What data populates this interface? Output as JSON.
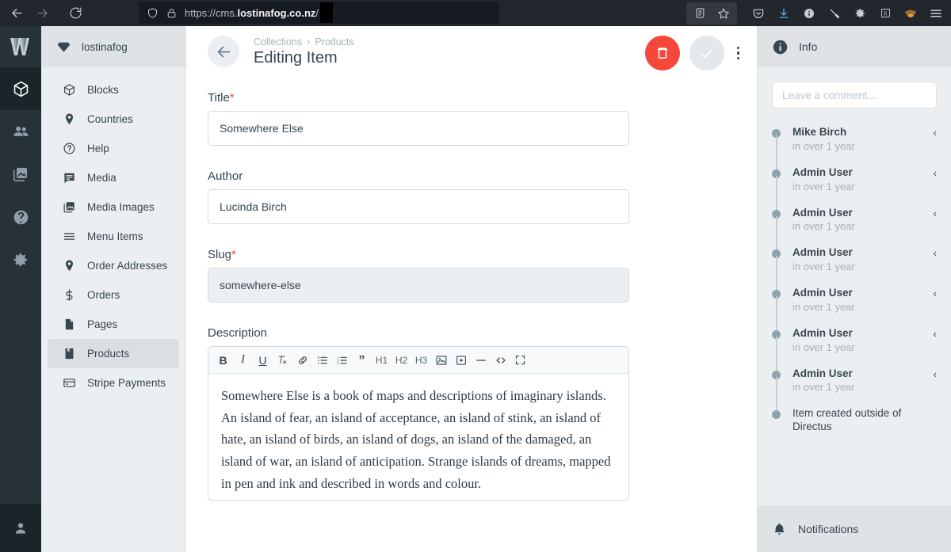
{
  "browser": {
    "back_icon": "arrow-left-icon",
    "forward_icon": "arrow-right-icon",
    "reload_icon": "reload-icon",
    "shield_icon": "shield-icon",
    "lock_icon": "lock-icon",
    "url_prefix": "https://cms.",
    "url_domain": "lostinafog.co.nz",
    "url_suffix": "/",
    "reader_icon": "reader-view-icon",
    "bookmark_icon": "star-icon",
    "extensions": [
      "pocket-icon",
      "downloads-icon",
      "info-circle-icon",
      "pen-icon",
      "gear-icon",
      "r-badge-icon",
      "monkey-avatar-icon"
    ],
    "menu_icon": "hamburger-menu-icon"
  },
  "modulebar": {
    "brand_label": "W",
    "items": [
      {
        "name": "content",
        "icon": "cube-icon",
        "active": true
      },
      {
        "name": "users",
        "icon": "users-icon",
        "active": false
      },
      {
        "name": "file-library",
        "icon": "photo-library-icon",
        "active": false
      },
      {
        "name": "docs",
        "icon": "question-circle-icon",
        "active": false
      },
      {
        "name": "settings",
        "icon": "gear-icon",
        "active": false
      }
    ],
    "bottom": {
      "name": "user-profile",
      "icon": "person-icon"
    }
  },
  "sidebar": {
    "project_name": "lostinafog",
    "project_icon": "directus-gem-icon",
    "items": [
      {
        "label": "Blocks",
        "icon": "cube-icon",
        "active": false
      },
      {
        "label": "Countries",
        "icon": "map-pin-icon",
        "active": false
      },
      {
        "label": "Help",
        "icon": "question-circle-icon",
        "active": false
      },
      {
        "label": "Media",
        "icon": "chat-bubble-icon",
        "active": false
      },
      {
        "label": "Media Images",
        "icon": "photo-library-icon",
        "active": false
      },
      {
        "label": "Menu Items",
        "icon": "list-lines-icon",
        "active": false
      },
      {
        "label": "Order Addresses",
        "icon": "map-pin-icon",
        "active": false
      },
      {
        "label": "Orders",
        "icon": "dollar-icon",
        "active": false
      },
      {
        "label": "Pages",
        "icon": "page-icon",
        "active": false
      },
      {
        "label": "Products",
        "icon": "book-icon",
        "active": true
      },
      {
        "label": "Stripe Payments",
        "icon": "credit-card-icon",
        "active": false
      }
    ]
  },
  "header": {
    "back_icon": "arrow-left-icon",
    "breadcrumb": {
      "root": "Collections",
      "separator": "›",
      "current": "Products"
    },
    "title": "Editing Item",
    "delete_label": "trash-icon",
    "save_label": "check-icon",
    "menu_label": "kebab-menu-icon",
    "delete_color": "#f5483b",
    "save_color": "#e5e8ea"
  },
  "form": {
    "fields": [
      {
        "label": "Title",
        "required": true,
        "value": "Somewhere Else",
        "readonly": false
      },
      {
        "label": "Author",
        "required": false,
        "value": "Lucinda Birch",
        "readonly": false
      },
      {
        "label": "Slug",
        "required": true,
        "value": "somewhere-else",
        "readonly": true
      }
    ],
    "description": {
      "label": "Description",
      "toolbar": [
        {
          "name": "bold",
          "glyph": "B",
          "type": "text"
        },
        {
          "name": "italic",
          "glyph": "I",
          "type": "text"
        },
        {
          "name": "underline",
          "glyph": "U",
          "type": "text"
        },
        {
          "name": "clear-formatting",
          "glyph": "T",
          "type": "svg"
        },
        {
          "name": "link",
          "glyph": "link",
          "type": "svg"
        },
        {
          "name": "bullet-list",
          "glyph": "ul",
          "type": "svg"
        },
        {
          "name": "ordered-list",
          "glyph": "ol",
          "type": "svg"
        },
        {
          "name": "blockquote",
          "glyph": "”",
          "type": "text"
        },
        {
          "name": "heading-1",
          "glyph": "H1",
          "type": "text"
        },
        {
          "name": "heading-2",
          "glyph": "H2",
          "type": "text"
        },
        {
          "name": "heading-3",
          "glyph": "H3",
          "type": "text"
        },
        {
          "name": "insert-image",
          "glyph": "image",
          "type": "svg"
        },
        {
          "name": "insert-video",
          "glyph": "video",
          "type": "svg"
        },
        {
          "name": "horizontal-rule",
          "glyph": "hr",
          "type": "svg"
        },
        {
          "name": "source-code",
          "glyph": "<>",
          "type": "text"
        },
        {
          "name": "fullscreen",
          "glyph": "fs",
          "type": "svg"
        }
      ],
      "body": "Somewhere Else is a book of maps and descriptions of imaginary islands. An island of fear, an island of acceptance, an island of stink, an island of hate, an island of birds, an island of dogs, an island of the damaged, an island of war, an island of anticipation. Strange islands of dreams, mapped in pen and ink and described in words and colour."
    }
  },
  "info": {
    "header_icon": "info-circle-icon",
    "header_title": "Info",
    "comment_placeholder": "Leave a comment...",
    "activity": [
      {
        "user": "Mike Birch",
        "time": "in over 1 year",
        "chevron": "‹",
        "line": true
      },
      {
        "user": "Admin User",
        "time": "in over 1 year",
        "chevron": "‹",
        "line": true
      },
      {
        "user": "Admin User",
        "time": "in over 1 year",
        "chevron": "‹",
        "line": true
      },
      {
        "user": "Admin User",
        "time": "in over 1 year",
        "chevron": "‹",
        "line": true
      },
      {
        "user": "Admin User",
        "time": "in over 1 year",
        "chevron": "‹",
        "line": true
      },
      {
        "user": "Admin User",
        "time": "in over 1 year",
        "chevron": "‹",
        "line": true
      },
      {
        "user": "Admin User",
        "time": "in over 1 year",
        "chevron": "‹",
        "line": true
      },
      {
        "user": "Item created outside of Directus",
        "time": "",
        "chevron": "",
        "line": false
      }
    ],
    "notifications_label": "Notifications",
    "notifications_icon": "bell-icon"
  }
}
